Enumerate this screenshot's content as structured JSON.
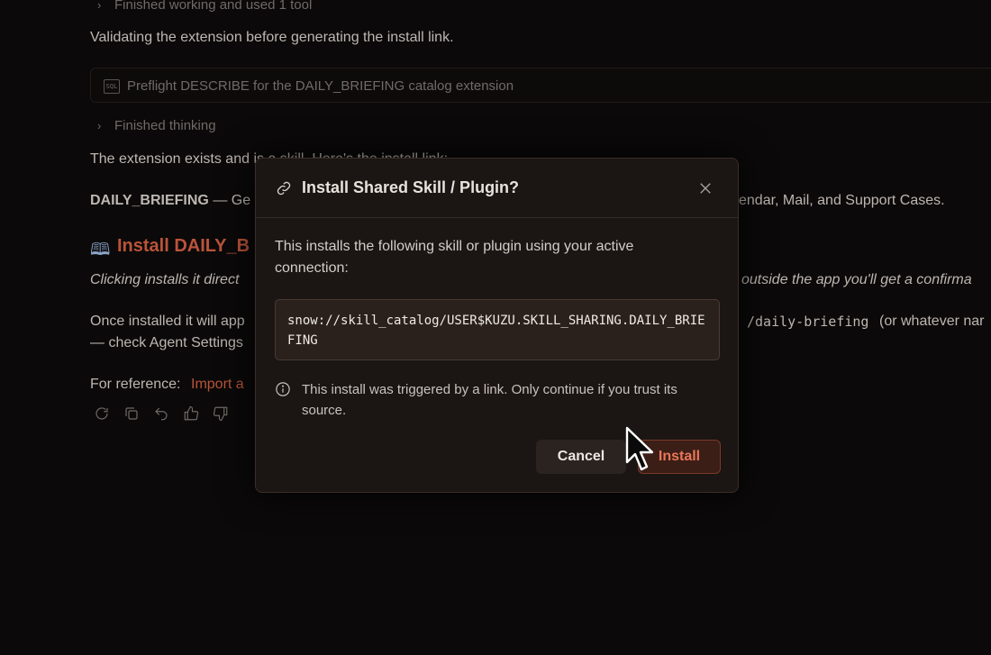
{
  "chat": {
    "tool_summary": "Finished working and used 1 tool",
    "validating_text": "Validating the extension before generating the install link.",
    "sql_step_label": "Preflight DESCRIBE for the DAILY_BRIEFING catalog extension",
    "sql_icon_text": "SQL",
    "thinking_summary": "Finished thinking",
    "exists_text": "The extension exists and is a skill. Here's the install link:",
    "briefing_name": "DAILY_BRIEFING",
    "briefing_dash": " — Ge",
    "briefing_tail": "endar, Mail, and Support Cases.",
    "install_heading": "Install DAILY_B",
    "clicking_left": "Clicking installs it direct",
    "clicking_right": "outside the app you'll get a confirma",
    "once_left": "Once installed it will app",
    "slash_command": "/daily-briefing",
    "once_right": "(or whatever nar",
    "agent_settings": "— check Agent Settings",
    "reference_label": "For reference:",
    "reference_link": "Import a"
  },
  "modal": {
    "title": "Install Shared Skill / Plugin?",
    "description": "This installs the following skill or plugin using your active connection:",
    "skill_uri": "snow://skill_catalog/USER$KUZU.SKILL_SHARING.DAILY_BRIEFING",
    "warning": "This install was triggered by a link. Only continue if you trust its source.",
    "cancel_label": "Cancel",
    "install_label": "Install"
  },
  "icons": {
    "link": "link-icon",
    "close": "close-icon",
    "info": "info-icon",
    "book": "book-icon"
  },
  "colors": {
    "accent": "#b9543a",
    "install_text": "#e8765a",
    "background": "#0b0909",
    "modal_bg": "#1b1513"
  }
}
